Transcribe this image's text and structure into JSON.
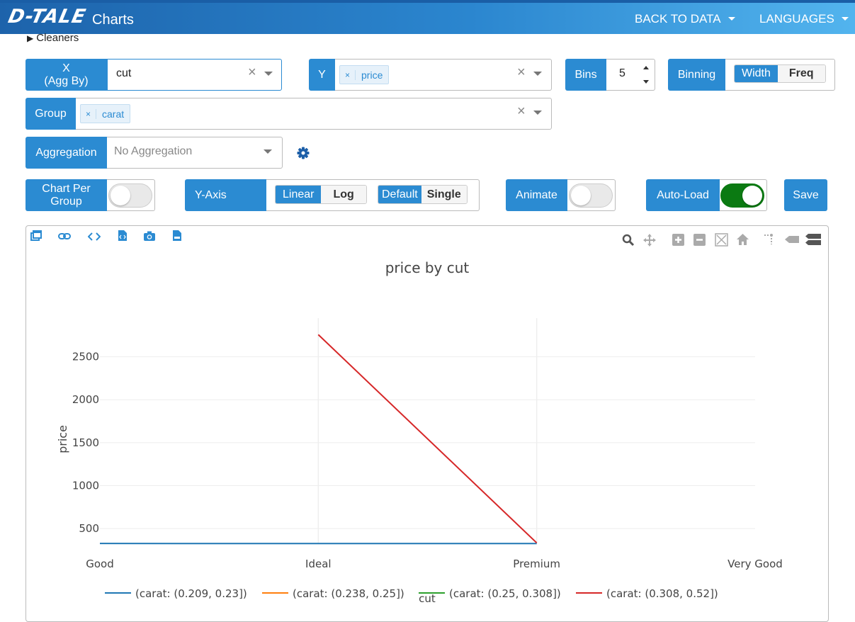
{
  "header": {
    "logo": "D-TALE",
    "title": "Charts",
    "nav": [
      {
        "label": "BACK TO DATA"
      },
      {
        "label": "LANGUAGES"
      }
    ]
  },
  "cleaners": {
    "label": "Cleaners"
  },
  "controls": {
    "x": {
      "label_line1": "X",
      "label_line2": "(Agg By)",
      "value": "cut"
    },
    "y": {
      "label": "Y",
      "tag": "price"
    },
    "bins": {
      "label": "Bins",
      "value": "5"
    },
    "binning": {
      "label": "Binning",
      "options": [
        "Width",
        "Freq"
      ],
      "active": "Width"
    },
    "group": {
      "label": "Group",
      "tag": "carat"
    },
    "aggregation": {
      "label": "Aggregation",
      "placeholder": "No Aggregation"
    },
    "chart_per_group": {
      "label_line1": "Chart Per",
      "label_line2": "Group",
      "on": false
    },
    "y_axis": {
      "label": "Y-Axis",
      "scale_options": [
        "Linear",
        "Log"
      ],
      "scale_active": "Linear",
      "mode_options": [
        "Default",
        "Single"
      ],
      "mode_active": "Default"
    },
    "animate": {
      "label": "Animate",
      "on": false
    },
    "auto_load": {
      "label": "Auto-Load",
      "on": true
    },
    "save": {
      "label": "Save"
    }
  },
  "chart_toolbar": {
    "left_icons": [
      "popup-icon",
      "link-icon",
      "code-icon",
      "export-html-icon",
      "camera-icon",
      "export-csv-icon"
    ],
    "right_icons": [
      "zoom-icon",
      "pan-icon",
      "zoom-in-icon",
      "zoom-out-icon",
      "autoscale-icon",
      "reset-axes-icon",
      "spike-lines-icon",
      "hover-closest-icon",
      "hover-compare-icon"
    ]
  },
  "chart_data": {
    "type": "line",
    "title": "price by cut",
    "xlabel": "cut",
    "ylabel": "price",
    "categories": [
      "Good",
      "Ideal",
      "Premium",
      "Very Good"
    ],
    "ylim": [
      320,
      2950
    ],
    "yticks": [
      500,
      1000,
      1500,
      2000,
      2500
    ],
    "grid": true,
    "legend_position": "bottom",
    "series": [
      {
        "name": "(carat: (0.209, 0.23])",
        "color": "#1f77b4",
        "points": [
          {
            "x": "Good",
            "y": 327
          },
          {
            "x": "Ideal",
            "y": 326
          },
          {
            "x": "Premium",
            "y": 326
          }
        ]
      },
      {
        "name": "(carat: (0.238, 0.25])",
        "color": "#ff7f0e",
        "points": []
      },
      {
        "name": "(carat: (0.25, 0.308])",
        "color": "#2ca02c",
        "points": []
      },
      {
        "name": "(carat: (0.308, 0.52])",
        "color": "#d62728",
        "points": [
          {
            "x": "Ideal",
            "y": 2757
          },
          {
            "x": "Premium",
            "y": 334
          }
        ]
      }
    ]
  }
}
